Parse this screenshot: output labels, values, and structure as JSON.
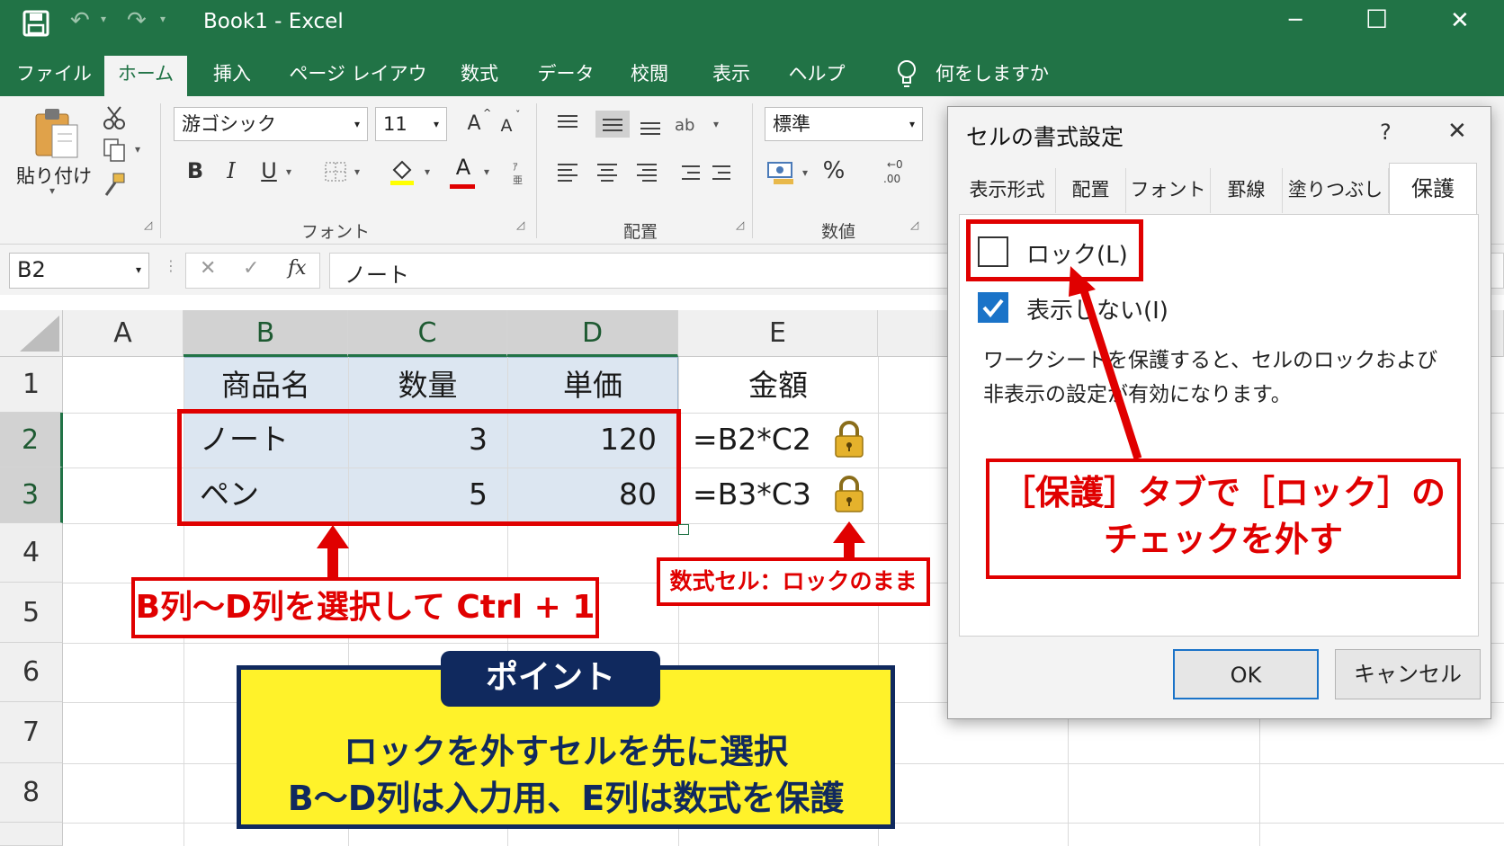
{
  "app": {
    "title": "Book1  -  Excel"
  },
  "window_controls": {
    "minimize": "─",
    "maximize": "☐",
    "close": "✕"
  },
  "qat": {
    "undo": "↶",
    "redo": "↷"
  },
  "menu": {
    "items": [
      "ファイル",
      "ホーム",
      "挿入",
      "ページ レイアウト",
      "数式",
      "データ",
      "校閲",
      "表示",
      "ヘルプ"
    ],
    "active": "ホーム",
    "tellme": "何をしますか"
  },
  "ribbon": {
    "paste_label": "貼り付け",
    "font_name": "游ゴシック",
    "font_size": "11",
    "bold": "B",
    "italic": "I",
    "underline": "U",
    "grow_font": "A",
    "shrink_font": "A",
    "font_color_glyph": "A",
    "number_format": "標準",
    "percent": "%",
    "group_font": "フォント",
    "group_align": "配置",
    "group_number": "数値"
  },
  "formula_bar": {
    "name_box": "B2",
    "cancel": "✕",
    "enter": "✓",
    "fx": "fx",
    "content": "ノート"
  },
  "sheet": {
    "columns": [
      "A",
      "B",
      "C",
      "D",
      "E"
    ],
    "rows": [
      "1",
      "2",
      "3",
      "4",
      "5",
      "6",
      "7",
      "8"
    ],
    "header_row": {
      "B": "商品名",
      "C": "数量",
      "D": "単価",
      "E": "金額"
    },
    "data": [
      {
        "B": "ノート",
        "C": "3",
        "D": "120",
        "E": "=B2*C2"
      },
      {
        "B": "ペン",
        "C": "5",
        "D": "80",
        "E": "=B3*C3"
      }
    ]
  },
  "annotations": {
    "select_callout": "B列～D列を選択して Ctrl + 1",
    "formula_callout": "数式セル：ロックのまま",
    "dialog_callout_line1": "［保護］タブで［ロック］の",
    "dialog_callout_line2": "チェックを外す",
    "point_title": "ポイント",
    "point_line1": "ロックを外すセルを先に選択",
    "point_line2": "B～D列は入力用、E列は数式を保護"
  },
  "dialog": {
    "title": "セルの書式設定",
    "help": "?",
    "close": "✕",
    "tabs": [
      "表示形式",
      "配置",
      "フォント",
      "罫線",
      "塗りつぶし",
      "保護"
    ],
    "active_tab": "保護",
    "lock_label": "ロック(L)",
    "lock_checked": false,
    "hidden_label": "表示しない(I)",
    "hidden_checked": true,
    "description_line1": "ワークシートを保護すると、セルのロックおよび",
    "description_line2": "非表示の設定が有効になります。",
    "ok": "OK",
    "cancel": "キャンセル"
  },
  "colors": {
    "excel_green": "#217346",
    "selection_fill": "#dce6f1",
    "callout_red": "#e00000",
    "point_yellow": "#fff22a",
    "point_navy": "#10295e",
    "check_blue": "#1a73c8"
  }
}
